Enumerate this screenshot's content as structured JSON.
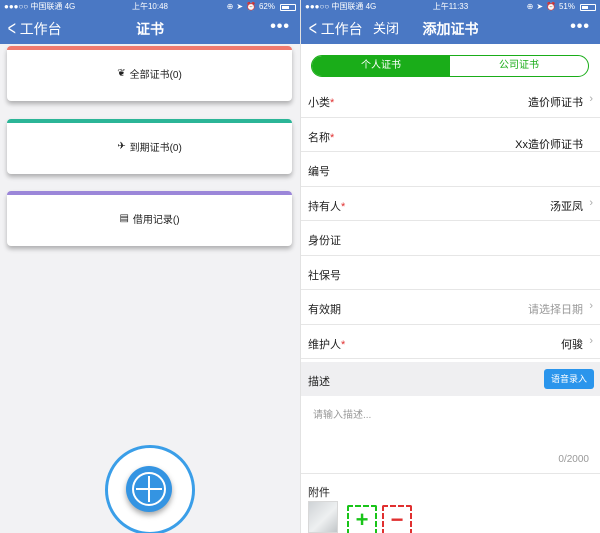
{
  "left": {
    "status": {
      "carrier": "●●●○○ 中国联通 4G",
      "time": "上午10:48",
      "battery": "62%",
      "battery_level": 0.62
    },
    "nav": {
      "back_label": "工作台",
      "title": "证书",
      "more": "•••"
    },
    "cards": [
      {
        "icon": "leaf-icon",
        "label": "全部证书(0)",
        "band_color": "#f07a6e"
      },
      {
        "icon": "paper-plane-icon",
        "label": "到期证书(0)",
        "band_color": "#2bb597"
      },
      {
        "icon": "list-icon",
        "label": "借用记录()",
        "band_color": "#9b86d9"
      }
    ],
    "fab_color": "#3494e2"
  },
  "right": {
    "status": {
      "carrier": "●●●○○ 中国联通 4G",
      "time": "上午11:33",
      "battery": "51%",
      "battery_level": 0.51
    },
    "nav": {
      "back_label": "工作台",
      "close_label": "关闭",
      "title": "添加证书",
      "more": "•••"
    },
    "tabs": {
      "personal": "个人证书",
      "company": "公司证书",
      "active_color": "#1aad19"
    },
    "fields": [
      {
        "label": "小类",
        "required": true,
        "value": "造价师证书",
        "arrow": true
      },
      {
        "label": "名称",
        "required": true,
        "value": "Xx造价师证书",
        "arrow": false
      },
      {
        "label": "编号",
        "required": false,
        "value": "",
        "arrow": false
      },
      {
        "label": "持有人",
        "required": true,
        "value": "汤亚凤",
        "arrow": true
      },
      {
        "label": "身份证",
        "required": false,
        "value": "",
        "arrow": false
      },
      {
        "label": "社保号",
        "required": false,
        "value": "",
        "arrow": false
      },
      {
        "label": "有效期",
        "required": false,
        "value": "请选择日期",
        "placeholder": true,
        "arrow": true
      },
      {
        "label": "维护人",
        "required": true,
        "value": "何骏",
        "arrow": true
      }
    ],
    "description": {
      "label": "描述",
      "voice_button": "语音录入",
      "placeholder": "请输入描述...",
      "counter": "0/2000"
    },
    "attachments": {
      "label": "附件",
      "add_symbol": "+",
      "remove_symbol": "−"
    }
  }
}
